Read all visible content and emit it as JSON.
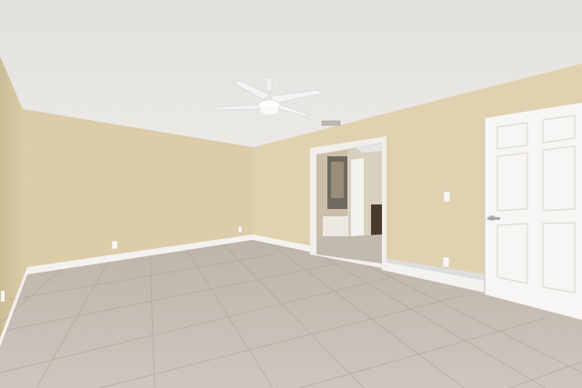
{
  "scene": {
    "kind": "photo",
    "subject": "empty-bedroom-interior",
    "elements": [
      "textured-ceiling",
      "ceiling-fan",
      "ceiling-vent",
      "beige-walls",
      "white-baseboards",
      "tile-floor",
      "open-doorway-to-bathroom",
      "white-six-panel-door",
      "light-switch",
      "wall-outlets"
    ]
  },
  "colors": {
    "ceiling": "#eceae7",
    "wall_left": "#d8c9a6",
    "wall_back": "#dfd0ad",
    "wall_right": "#e1d3b2",
    "floor": "#c7bdb3",
    "floor_grout": "#a99f96",
    "baseboard": "#f4f2ee",
    "door": "#f7f6f4",
    "door_frame": "#efede9",
    "fan": "#f2f2f2"
  }
}
